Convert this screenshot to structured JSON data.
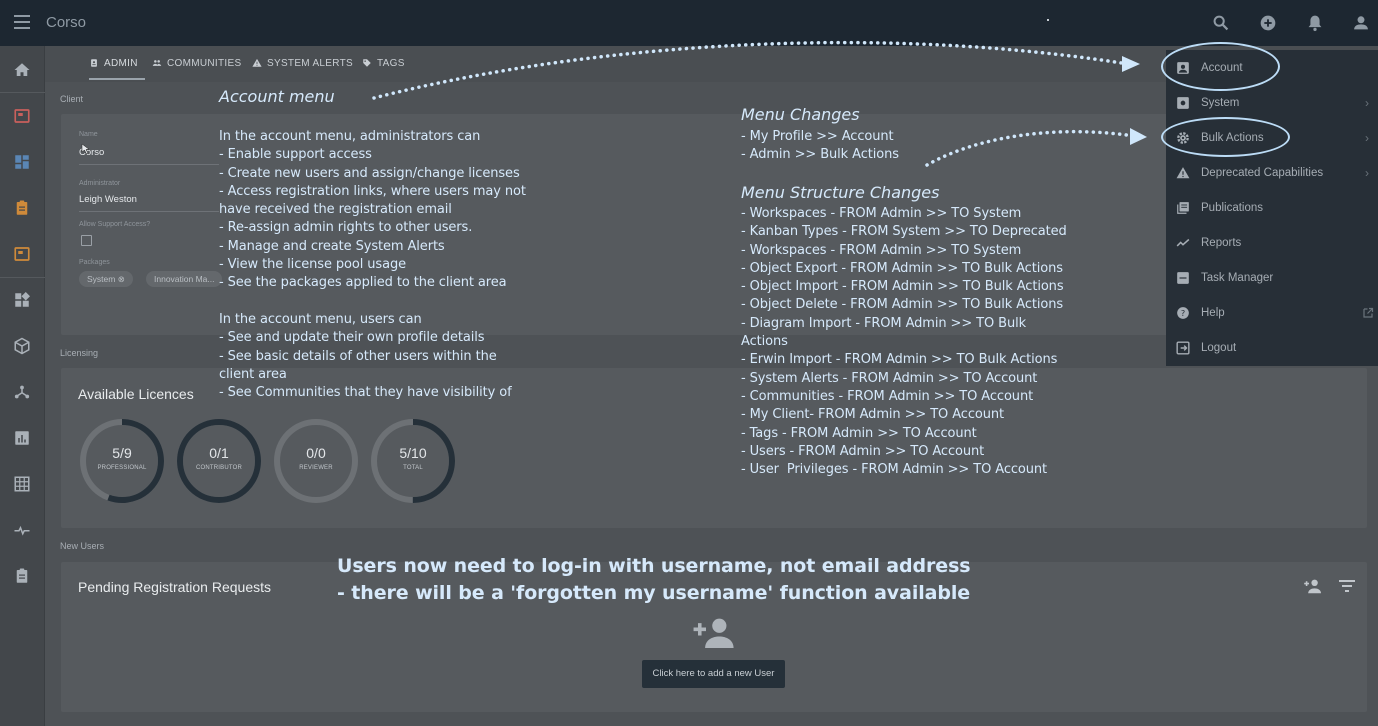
{
  "topbar": {
    "brand": "Corso",
    "icons": [
      "search-icon",
      "add-circle-icon",
      "bell-icon",
      "user-icon"
    ]
  },
  "sidebar": {
    "icons": [
      "home-icon",
      "board-icon",
      "dashboard-icon",
      "clipboard-icon",
      "board-alt-icon",
      "widgets-icon",
      "cube-icon",
      "hierarchy-icon",
      "bar-chart-icon",
      "grid-icon",
      "flow-icon",
      "clipboard-list-icon"
    ]
  },
  "tabs": [
    {
      "label": "ADMIN",
      "icon": "id-badge-icon",
      "active": true
    },
    {
      "label": "COMMUNITIES",
      "icon": "people-icon",
      "active": false
    },
    {
      "label": "SYSTEM ALERTS",
      "icon": "warning-icon",
      "active": false
    },
    {
      "label": "TAGS",
      "icon": "tag-icon",
      "active": false
    }
  ],
  "client": {
    "section_label": "Client",
    "name_label": "Name",
    "name_value": "Corso",
    "admin_label": "Administrator",
    "admin_value": "Leigh Weston",
    "support_label": "Allow Support Access?",
    "packages_label": "Packages",
    "packages": [
      "System",
      "Innovation Ma..."
    ]
  },
  "licensing": {
    "section_label": "Licensing",
    "title": "Available Licences",
    "rings": [
      {
        "value": "5/9",
        "label": "PROFESSIONAL",
        "used": 5,
        "total": 9
      },
      {
        "value": "0/1",
        "label": "CONTRIBUTOR",
        "used": 0,
        "total": 1
      },
      {
        "value": "0/0",
        "label": "REVIEWER",
        "used": 0,
        "total": 0
      },
      {
        "value": "5/10",
        "label": "TOTAL",
        "used": 5,
        "total": 10
      }
    ]
  },
  "new_users": {
    "section_label": "New Users",
    "title": "Pending Registration Requests",
    "add_button": "Click here to add a new User"
  },
  "menu": {
    "items": [
      {
        "label": "Account",
        "icon": "account-box-icon",
        "submenu": false
      },
      {
        "label": "System",
        "icon": "system-icon",
        "submenu": true
      },
      {
        "label": "Bulk Actions",
        "icon": "gear-icon",
        "submenu": true
      },
      {
        "label": "Deprecated Capabilities",
        "icon": "warning-icon",
        "submenu": true
      },
      {
        "label": "Publications",
        "icon": "publications-icon",
        "submenu": false
      },
      {
        "label": "Reports",
        "icon": "trend-icon",
        "submenu": false
      },
      {
        "label": "Task Manager",
        "icon": "task-icon",
        "submenu": false
      },
      {
        "label": "Help",
        "icon": "help-icon",
        "submenu": false,
        "external": true
      },
      {
        "label": "Logout",
        "icon": "logout-icon",
        "submenu": false
      }
    ]
  },
  "annotations": {
    "account_title": "Account menu",
    "account_body": "In the account menu, administrators can\n- Enable support access\n- Create new users and assign/change licenses\n- Access registration links, where users may not\nhave received the registration email\n- Re-assign admin rights to other users.\n- Manage and create System Alerts\n- View the license pool usage\n- See the packages applied to the client area\n\nIn the account menu, users can\n- See and update their own profile details\n- See basic details of other users within the\nclient area\n- See Communities that they have visibility of",
    "changes_title": "Menu Changes",
    "changes_body": "- My Profile >> Account\n- Admin >> Bulk Actions",
    "structure_title": "Menu Structure Changes",
    "structure_body": "- Workspaces - FROM Admin >> TO System\n- Kanban Types - FROM System >> TO Deprecated\n- Workspaces - FROM Admin >> TO System\n- Object Export - FROM Admin >> TO Bulk Actions\n- Object Import - FROM Admin >> TO Bulk Actions\n- Object Delete - FROM Admin >> TO Bulk Actions\n- Diagram Import - FROM Admin >> TO Bulk\nActions\n- Erwin Import - FROM Admin >> TO Bulk Actions\n- System Alerts - FROM Admin >> TO Account\n- Communities - FROM Admin >> TO Account\n- My Client- FROM Admin >> TO Account\n- Tags - FROM Admin >> TO Account\n- Users - FROM Admin >> TO Account\n- User  Privileges - FROM Admin >> TO Account",
    "username_note": "Users now need to log-in with username, not email address\n- there will be a 'forgotten my username' function available"
  },
  "colors": {
    "topbar": "#1d2731",
    "menu": "#272f37",
    "annotation": "#d6e9fb",
    "highlight": "#bcdcf6"
  }
}
